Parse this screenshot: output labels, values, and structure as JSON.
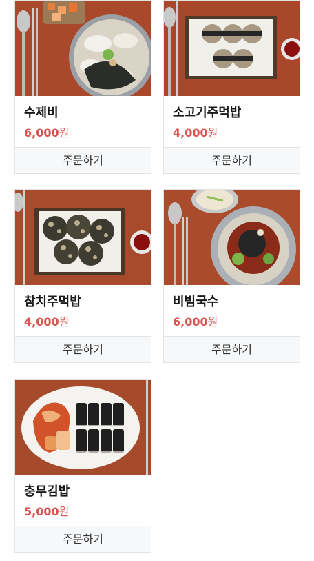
{
  "menu": {
    "items": [
      {
        "name": "수제비",
        "price": "6,000",
        "currency": "원",
        "order_label": "주문하기",
        "image": "sujebi-photo"
      },
      {
        "name": "소고기주먹밥",
        "price": "4,000",
        "currency": "원",
        "order_label": "주문하기",
        "image": "beef-rice-ball-photo"
      },
      {
        "name": "참치주먹밥",
        "price": "4,000",
        "currency": "원",
        "order_label": "주문하기",
        "image": "tuna-rice-ball-photo"
      },
      {
        "name": "비빔국수",
        "price": "6,000",
        "currency": "원",
        "order_label": "주문하기",
        "image": "bibim-noodles-photo"
      },
      {
        "name": "충무김밥",
        "price": "5,000",
        "currency": "원",
        "order_label": "주문하기",
        "image": "chungmu-gimbap-photo"
      }
    ]
  },
  "colors": {
    "price": "#d9534f",
    "order_background": "#f7f8fa",
    "card_border": "#e3e3e3",
    "table_wood": "#b04e2c"
  }
}
